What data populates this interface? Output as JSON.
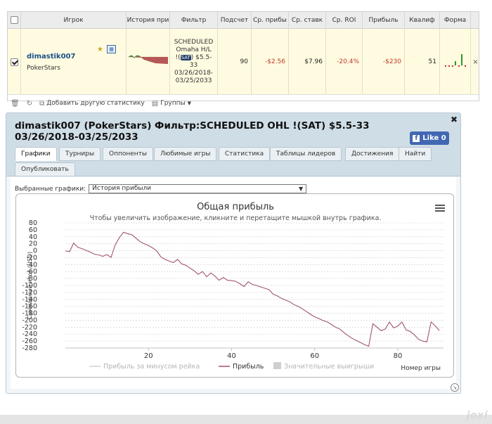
{
  "table": {
    "headers": {
      "player": "Игрок",
      "history": "История при",
      "filter": "Фильтр",
      "count": "Подсчет",
      "avg_profit": "Ср. прибы",
      "avg_stake": "Ср. ставк",
      "avg_roi": "Ср. ROI",
      "profit": "Прибыль",
      "qualify": "Квалиф",
      "form": "Форма"
    },
    "row": {
      "player_name": "dimastik007",
      "site": "PokerStars",
      "filter_text": "SCHEDULED Omaha H/L !(SAT) $5.5-33 03/26/2018-03/25/2033",
      "filter_line1": "SCHEDULED",
      "filter_line2": "Omaha H/L",
      "filter_line3a": "!(",
      "filter_sat": "SAT",
      "filter_line3b": ") $5.5-",
      "filter_line4": "33",
      "filter_line5": "03/26/2018-",
      "filter_line6": "03/25/2033",
      "count": "90",
      "avg_profit": "-$2.56",
      "avg_stake": "$7.96",
      "avg_roi": "-20.4%",
      "profit": "-$230",
      "qualify": "51"
    },
    "toolbar": {
      "add_stats": "Добавить другую статистику",
      "groups": "Группы"
    }
  },
  "window": {
    "title": "dimastik007 (PokerStars) Фильтр:SCHEDULED OHL !(SAT) $5.5-33 03/26/2018-03/25/2033",
    "like_label": "Like 0",
    "tabs": [
      "Графики",
      "Турниры",
      "Оппоненты",
      "Любимые игры",
      "Статистика",
      "Таблицы лидеров",
      "Достижения",
      "Найти",
      "Опубликовать"
    ],
    "selected_tab": "Графики",
    "selector_label": "Выбранные графики:",
    "selector_value": "История прибыли"
  },
  "chart_data": {
    "type": "line",
    "title": "Общая прибыль",
    "subtitle": "Чтобы увеличить изображение, кликните и перетащите мышкой внутрь графика.",
    "ylabel": "Суммарный итог (USD)",
    "xlabel": "Номер игры",
    "ylim": [
      -280,
      80
    ],
    "y_ticks": [
      80,
      60,
      40,
      20,
      0,
      -20,
      -40,
      -60,
      -80,
      -100,
      -120,
      -140,
      -160,
      -180,
      -200,
      -220,
      -240,
      -260,
      -280
    ],
    "xlim": [
      0,
      91
    ],
    "x_ticks": [
      20,
      40,
      60,
      80
    ],
    "grid": true,
    "legend_position": "bottom",
    "legend": [
      "Прибыль за минусом рейка",
      "Прибыль",
      "Значительные выигрыши"
    ],
    "series": [
      {
        "name": "Прибыль",
        "color": "#a0566a",
        "x": [
          0,
          1,
          2,
          3,
          4,
          5,
          6,
          7,
          8,
          9,
          10,
          11,
          12,
          13,
          14,
          15,
          16,
          17,
          18,
          19,
          20,
          21,
          22,
          23,
          24,
          25,
          26,
          27,
          28,
          29,
          30,
          31,
          32,
          33,
          34,
          35,
          36,
          37,
          38,
          39,
          40,
          41,
          42,
          43,
          44,
          45,
          46,
          47,
          48,
          49,
          50,
          51,
          52,
          53,
          54,
          55,
          56,
          57,
          58,
          59,
          60,
          61,
          62,
          63,
          64,
          65,
          66,
          67,
          68,
          69,
          70,
          71,
          72,
          73,
          74,
          75,
          76,
          77,
          78,
          79,
          80,
          81,
          82,
          83,
          84,
          85,
          86,
          87,
          88,
          89,
          90
        ],
        "values": [
          0,
          -3,
          22,
          10,
          6,
          1,
          -4,
          -10,
          -12,
          -16,
          -11,
          -19,
          17,
          38,
          53,
          49,
          46,
          36,
          26,
          20,
          15,
          8,
          -1,
          -18,
          -25,
          -30,
          -34,
          -25,
          -38,
          -42,
          -50,
          -58,
          -68,
          -60,
          -75,
          -64,
          -73,
          -85,
          -77,
          -85,
          -86,
          -88,
          -95,
          -103,
          -89,
          -97,
          -100,
          -104,
          -108,
          -112,
          -125,
          -130,
          -137,
          -142,
          -147,
          -155,
          -160,
          -167,
          -175,
          -183,
          -190,
          -195,
          -201,
          -205,
          -212,
          -220,
          -225,
          -235,
          -244,
          -252,
          -258,
          -264,
          -270,
          -275,
          -210,
          -220,
          -230,
          -225,
          -205,
          -222,
          -217,
          -205,
          -228,
          -232,
          -242,
          -255,
          -260,
          -262,
          -205,
          -216,
          -230
        ]
      }
    ]
  }
}
